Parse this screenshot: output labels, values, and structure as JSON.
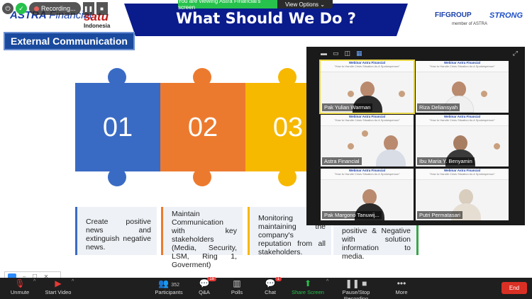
{
  "slide": {
    "title": "What Should We Do ?",
    "section_label": "External Communication",
    "logos": {
      "astra": "ASTRA",
      "astra_sub": "Financial",
      "satu": "satu",
      "satu_sub": "Indonesia",
      "fif": "FIFGROUP",
      "fif_sub": "member of ASTRA",
      "strong": "STRONG"
    },
    "pieces": [
      {
        "number": "01",
        "color": "#3a6bc4"
      },
      {
        "number": "02",
        "color": "#ec7a2e"
      },
      {
        "number": "03",
        "color": "#f7b800"
      }
    ],
    "boxes": [
      "Create positive news and extinguish negative news.",
      "Maintain Communication with key stakeholders (Media, Security, LSM, Ring 1, Goverment)",
      "Monitoring maintaining the company's reputation from all stakeholders.",
      "positive & Negative with solution information to media."
    ]
  },
  "recording": {
    "status": "Recording..."
  },
  "banner": {
    "viewing": "You are viewing Astra Financial's screen",
    "view_options": "View Options"
  },
  "gallery": {
    "webinar_title": "Webinar Astra Financial",
    "webinar_sub": "\"How to Handle Crisis Situation As A Spokesperson\"",
    "participants": [
      {
        "name": "Pak Yulian Warman",
        "active": true,
        "shirt": "#2c2c2c"
      },
      {
        "name": "Riza Deliansyah",
        "active": false,
        "shirt": "#f0f0f0"
      },
      {
        "name": "Astra Financial",
        "active": false,
        "shirt": "#d8dde6"
      },
      {
        "name": "Ibu Maria Y. Benyamin",
        "active": false,
        "shirt": "#3a3a3a"
      },
      {
        "name": "Pak Margono Tanuwij...",
        "active": false,
        "shirt": "#2a2a2a"
      },
      {
        "name": "Putri Permatasari",
        "active": false,
        "shirt": "#e6ded2"
      }
    ]
  },
  "toolbar": {
    "unmute": "Unmute",
    "start_video": "Start Video",
    "participants": "Participants",
    "participants_count": "352",
    "qa": "Q&A",
    "qa_badge": "18",
    "polls": "Polls",
    "chat": "Chat",
    "chat_badge": "1",
    "share": "Share Screen",
    "record": "Pause/Stop Recording",
    "more": "More",
    "end": "End"
  }
}
